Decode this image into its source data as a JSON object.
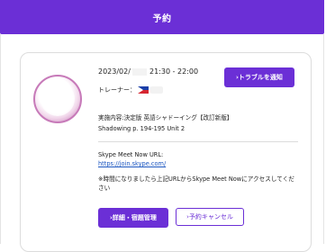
{
  "header": {
    "title": "予約"
  },
  "reservation": {
    "datetime": "2023/02/",
    "time_range": "21:30 - 22:00",
    "teacher_label": "トレーナー：",
    "report_button": "›トラブルを通知",
    "lesson_content": "実施内容:決定版 英語シャドーイング【改訂新版】",
    "lesson_page": "Shadowing p. 194-195 Unit 2",
    "skype_label": "Skype Meet Now URL:",
    "skype_url": "https://join.skype.com/",
    "notice": "※時間になりましたら上記URLからSkype Meet Nowにアクセスしてください",
    "detail_button": "›詳細・宿題管理",
    "cancel_button": "›予約キャンセル"
  },
  "colors": {
    "accent": "#6b2fd6",
    "link": "#1a55c0"
  },
  "icons": {
    "avatar": "trainer-avatar",
    "flag": "philippines-flag-icon"
  }
}
